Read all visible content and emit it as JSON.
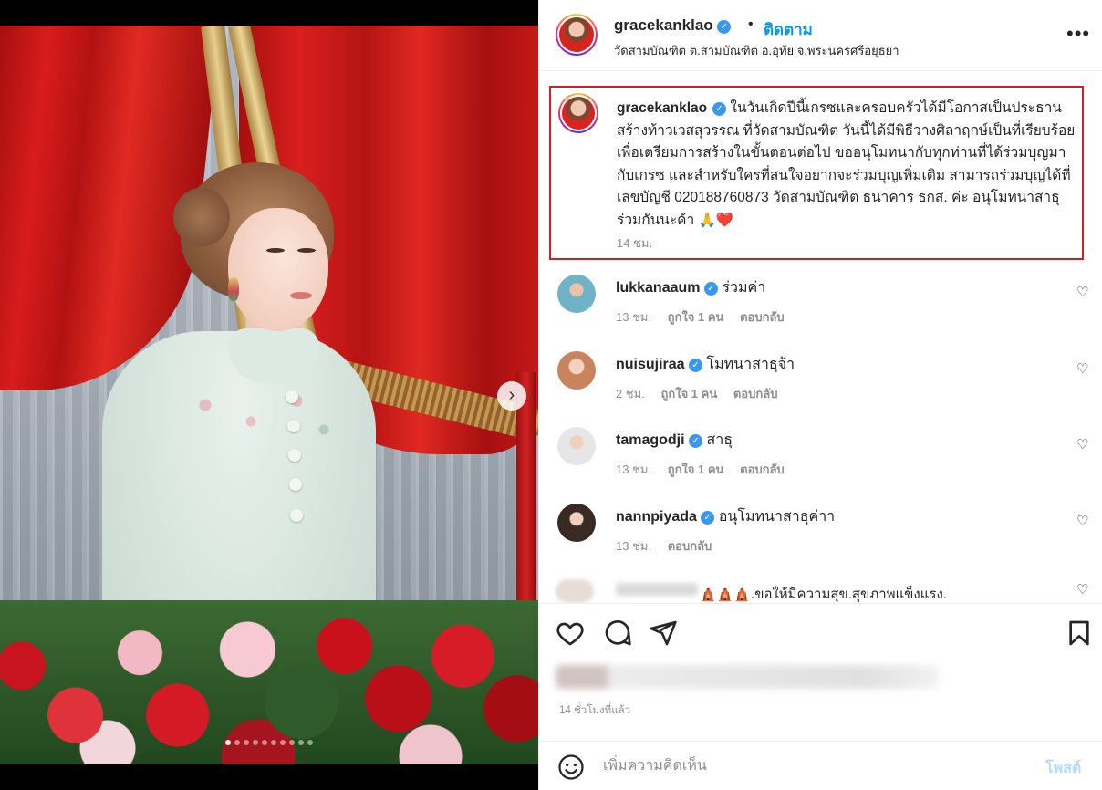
{
  "post": {
    "carousel_total": 10,
    "carousel_index": 1,
    "next_icon": "chevron-right-icon"
  },
  "header": {
    "username": "gracekanklao",
    "dot": "•",
    "follow_label": "ติดตาม",
    "location": "วัดสามบัณฑิต ต.สามบัณฑิต อ.อุทัย จ.พระนครศรีอยุธยา",
    "more_label": "•••"
  },
  "caption": {
    "username": "gracekanklao",
    "text": "ในวันเกิดปีนี้เกรซและครอบครัวได้มีโอกาสเป็นประธานสร้างท้าวเวสสุวรรณ ที่วัดสามบัณฑิต วันนี้ได้มีพิธีวางศิลาฤกษ์เป็นที่เรียบร้อย เพื่อเตรียมการสร้างในขั้นตอนต่อไป ขออนุโมทนากับทุกท่านที่ได้ร่วมบุญมากับเกรซ และสำหรับใครที่สนใจอยากจะร่วมบุญเพิ่มเติม สามารถร่วมบุญได้ที่เลขบัญชี 020188760873 วัดสามบัณฑิต ธนาคาร ธกส. ค่ะ อนุโมทนาสาธุร่วมกันนะค้า 🙏❤️",
    "time": "14 ชม.",
    "highlight_color": "#cf1f27"
  },
  "comments": [
    {
      "username": "lukkanaaum",
      "text": "ร่วมค่า",
      "time": "13 ชม.",
      "likes": "ถูกใจ 1 คน",
      "reply": "ตอบกลับ"
    },
    {
      "username": "nuisujiraa",
      "text": "โมทนาสาธุจ้า",
      "time": "2 ชม.",
      "likes": "ถูกใจ 1 คน",
      "reply": "ตอบกลับ"
    },
    {
      "username": "tamagodji",
      "text": "สาธุ",
      "time": "13 ชม.",
      "likes": "ถูกใจ 1 คน",
      "reply": "ตอบกลับ"
    },
    {
      "username": "nannpiyada",
      "text": "อนุโมทนาสาธุค่าา",
      "time": "13 ชม.",
      "reply": "ตอบกลับ"
    }
  ],
  "blurred_comment": {
    "text": "🛕🛕🛕.ขอให้มีความสุข.สุขภาพแข็งแรง."
  },
  "actions": {
    "like_icon": "heart-icon",
    "comment_icon": "comment-icon",
    "share_icon": "share-icon",
    "save_icon": "bookmark-icon"
  },
  "post_time": "14 ชั่วโมงที่แล้ว",
  "add_comment": {
    "placeholder": "เพิ่มความคิดเห็น",
    "post_label": "โพสต์"
  },
  "colors": {
    "link": "#0095f6",
    "verified": "#3897f0",
    "muted": "#8e8e8e"
  }
}
